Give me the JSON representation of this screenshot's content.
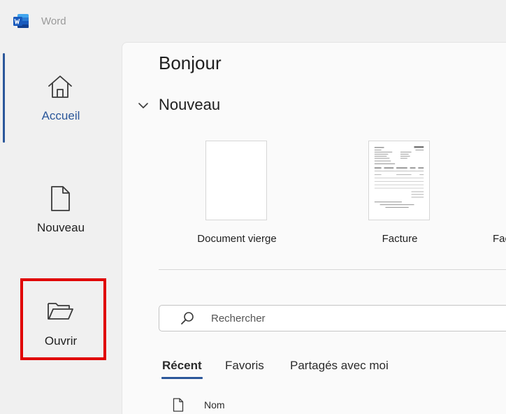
{
  "titlebar": {
    "app_name": "Word"
  },
  "sidebar": {
    "items": [
      {
        "label": "Accueil",
        "icon": "home-icon",
        "active": true
      },
      {
        "label": "Nouveau",
        "icon": "new-document-icon",
        "active": false
      },
      {
        "label": "Ouvrir",
        "icon": "open-folder-icon",
        "active": false
      }
    ]
  },
  "main": {
    "greeting": "Bonjour",
    "new_section": {
      "title": "Nouveau",
      "templates": [
        {
          "label": "Document vierge"
        },
        {
          "label": "Facture"
        },
        {
          "label": "Fac"
        }
      ]
    },
    "search": {
      "placeholder": "Rechercher"
    },
    "tabs": [
      {
        "label": "Récent",
        "active": true
      },
      {
        "label": "Favoris",
        "active": false
      },
      {
        "label": "Partagés avec moi",
        "active": false
      }
    ],
    "list": {
      "columns": [
        "Nom"
      ]
    }
  },
  "colors": {
    "accent": "#2b579a",
    "highlight": "#e00000",
    "sidebar_bg": "#f0f0f0",
    "content_bg": "#fafafa"
  }
}
